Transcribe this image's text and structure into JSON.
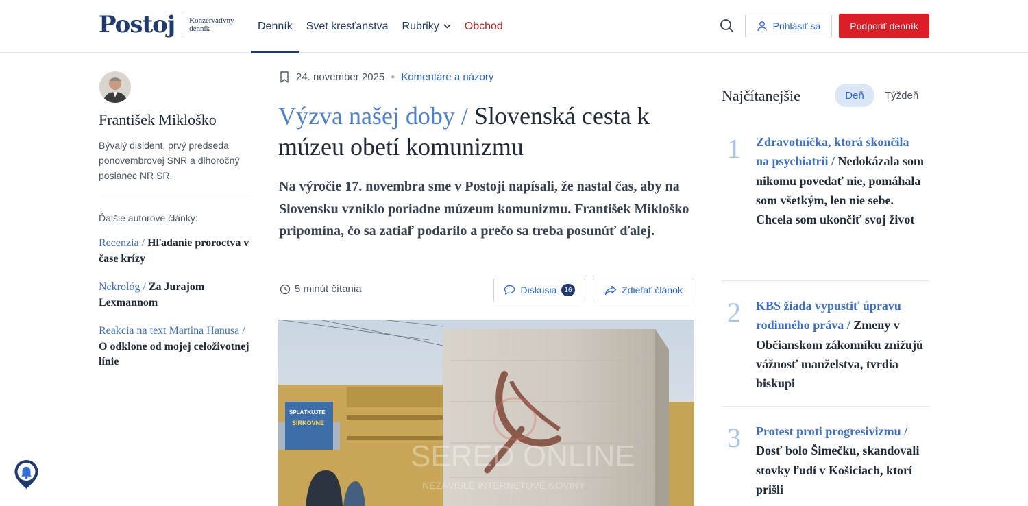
{
  "header": {
    "logo": "Postoj",
    "tagline_line1": "Konzervatívny",
    "tagline_line2": "denník",
    "nav": [
      {
        "label": "Denník",
        "active": true
      },
      {
        "label": "Svet kresťanstva"
      },
      {
        "label": "Rubriky"
      },
      {
        "label": "Obchod"
      }
    ],
    "search_icon": "search-icon",
    "login_label": "Prihlásiť sa",
    "support_label": "Podporiť denník"
  },
  "author": {
    "name": "František Mikloško",
    "bio": "Bývalý disident, prvý predseda ponovembrovej SNR a dlhoročný poslanec NR SR.",
    "more_label": "Ďalšie autorove články:",
    "articles": [
      {
        "rubric": "Recenzia / ",
        "title": "Hľadanie proroctva v čase krízy"
      },
      {
        "rubric": "Nekrológ / ",
        "title": "Za Jurajom Lexmannom"
      },
      {
        "rubric": "Reakcia na text Martina Hanusa / ",
        "title": "O odklone od mojej celoživotnej línie"
      }
    ]
  },
  "article": {
    "date": "24. november 2025",
    "category": "Komentáre a názory",
    "title_rubric": "Výzva našej doby / ",
    "title": "Slovenská cesta k múzeu obetí komunizmu",
    "lead": "Na výročie 17. novembra sme v Postoji napísali, že nastal čas, aby na Slovensku vzniklo poriadne múzeum komunizmu. František Mikloško pripomína, čo sa zatiaľ podarilo a prečo sa treba posunúť ďalej.",
    "read_time": "5 minút čítania",
    "discussion_label": "Diskusia",
    "discussion_count": "16",
    "share_label": "Zdieľať článok",
    "image_watermark": "SERED ONLINE",
    "image_watermark_sub": "NEZÁVISLÉ INTERNETOVÉ NOVINY",
    "billboard_text1": "SPLÁTKUJTE",
    "billboard_text2": "SIRKOVNE"
  },
  "most_read": {
    "heading": "Najčítanejšie",
    "tab_day": "Deň",
    "tab_week": "Týždeň",
    "items": [
      {
        "num": "1",
        "rubric": "Zdravotníčka, ktorá skončila na psychiatrii / ",
        "title": "Nedokázala som nikomu povedať nie, pomáhala som všetkým, len nie sebe. Chcela som ukončiť svoj život"
      },
      {
        "num": "2",
        "rubric": "KBS žiada vypustiť úpravu rodinného práva / ",
        "title": "Zmeny v Občianskom zákonníku znižujú vážnosť manželstva, tvrdia biskupi"
      },
      {
        "num": "3",
        "rubric": "Protest proti progresivizmu / ",
        "title": "Dosť bolo Šimečku, skandovali stovky ľudí v Košiciach, ktorí prišli"
      }
    ]
  },
  "colors": {
    "brand_navy": "#1e3a6e",
    "accent_blue": "#2563eb",
    "support_red": "#dc1f26"
  }
}
